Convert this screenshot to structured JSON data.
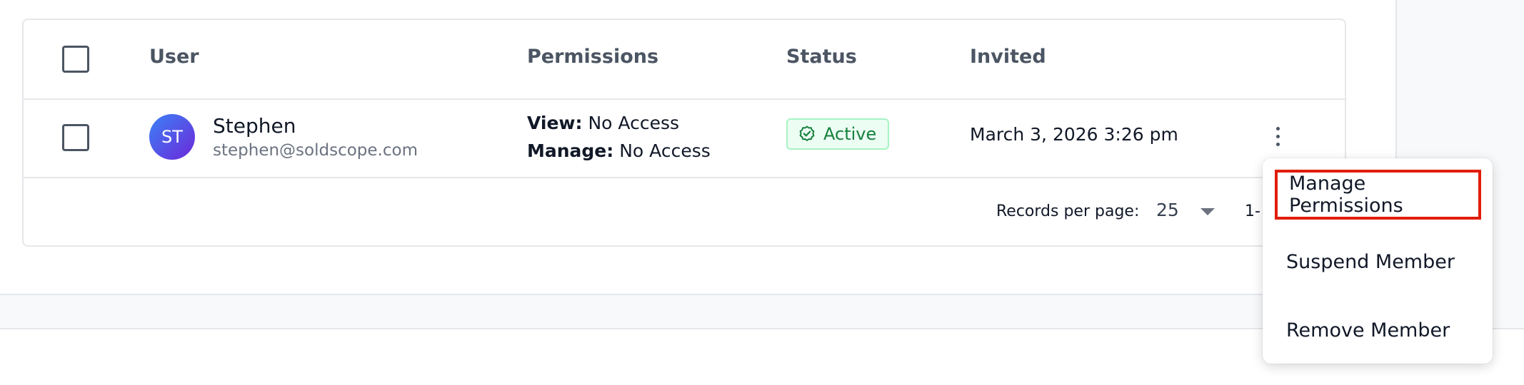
{
  "table": {
    "headers": {
      "user": "User",
      "permissions": "Permissions",
      "status": "Status",
      "invited": "Invited"
    },
    "rows": [
      {
        "initials": "ST",
        "name": "Stephen",
        "email": "stephen@soldscope.com",
        "view_label": "View:",
        "view_value": "No Access",
        "manage_label": "Manage:",
        "manage_value": "No Access",
        "status": "Active",
        "invited": "March 3, 2026 3:26 pm"
      }
    ]
  },
  "pagination": {
    "records_label": "Records per page:",
    "per_page": "25",
    "range": "1-"
  },
  "menu": {
    "items": [
      "Manage Permissions",
      "Suspend Member",
      "Remove Member"
    ]
  },
  "colors": {
    "status_active": "#15803d",
    "highlight_border": "#e11d07",
    "avatar_gradient_start": "#3b82f6",
    "avatar_gradient_end": "#6d28d9"
  },
  "icons": {
    "status": "check-circle-icon",
    "row_actions": "kebab-menu-icon",
    "select": "caret-down-icon"
  }
}
